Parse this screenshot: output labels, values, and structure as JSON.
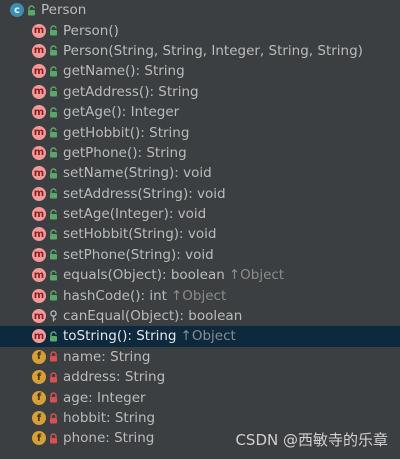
{
  "class_name": "Person",
  "members": [
    {
      "kind": "method",
      "visibility": "public",
      "label": "Person()",
      "inherited": ""
    },
    {
      "kind": "method",
      "visibility": "public",
      "label": "Person(String, String, Integer, String, String)",
      "inherited": ""
    },
    {
      "kind": "method",
      "visibility": "public",
      "label": "getName(): String",
      "inherited": ""
    },
    {
      "kind": "method",
      "visibility": "public",
      "label": "getAddress(): String",
      "inherited": ""
    },
    {
      "kind": "method",
      "visibility": "public",
      "label": "getAge(): Integer",
      "inherited": ""
    },
    {
      "kind": "method",
      "visibility": "public",
      "label": "getHobbit(): String",
      "inherited": ""
    },
    {
      "kind": "method",
      "visibility": "public",
      "label": "getPhone(): String",
      "inherited": ""
    },
    {
      "kind": "method",
      "visibility": "public",
      "label": "setName(String): void",
      "inherited": ""
    },
    {
      "kind": "method",
      "visibility": "public",
      "label": "setAddress(String): void",
      "inherited": ""
    },
    {
      "kind": "method",
      "visibility": "public",
      "label": "setAge(Integer): void",
      "inherited": ""
    },
    {
      "kind": "method",
      "visibility": "public",
      "label": "setHobbit(String): void",
      "inherited": ""
    },
    {
      "kind": "method",
      "visibility": "public",
      "label": "setPhone(String): void",
      "inherited": ""
    },
    {
      "kind": "method",
      "visibility": "public",
      "label": "equals(Object): boolean",
      "inherited": "↑Object"
    },
    {
      "kind": "method",
      "visibility": "public",
      "label": "hashCode(): int",
      "inherited": "↑Object"
    },
    {
      "kind": "method",
      "visibility": "protected",
      "label": "canEqual(Object): boolean",
      "inherited": ""
    },
    {
      "kind": "method",
      "visibility": "public",
      "label": "toString(): String",
      "inherited": "↑Object",
      "selected": true
    },
    {
      "kind": "field",
      "visibility": "private",
      "label": "name: String",
      "inherited": ""
    },
    {
      "kind": "field",
      "visibility": "private",
      "label": "address: String",
      "inherited": ""
    },
    {
      "kind": "field",
      "visibility": "private",
      "label": "age: Integer",
      "inherited": ""
    },
    {
      "kind": "field",
      "visibility": "private",
      "label": "hobbit: String",
      "inherited": ""
    },
    {
      "kind": "field",
      "visibility": "private",
      "label": "phone: String",
      "inherited": ""
    }
  ],
  "icons": {
    "class_letter": "c",
    "method_letter": "m",
    "field_letter": "f"
  },
  "colors": {
    "background": "#3c3f41",
    "selection": "#0d293e",
    "class_icon": "#3b8fb5",
    "method_icon": "#f29a9a",
    "field_icon": "#d5a136",
    "public_lock": "#59a869",
    "private_lock": "#d9504f",
    "protected_key": "#b2b2b2"
  },
  "watermark": "CSDN @西敏寺的乐章"
}
